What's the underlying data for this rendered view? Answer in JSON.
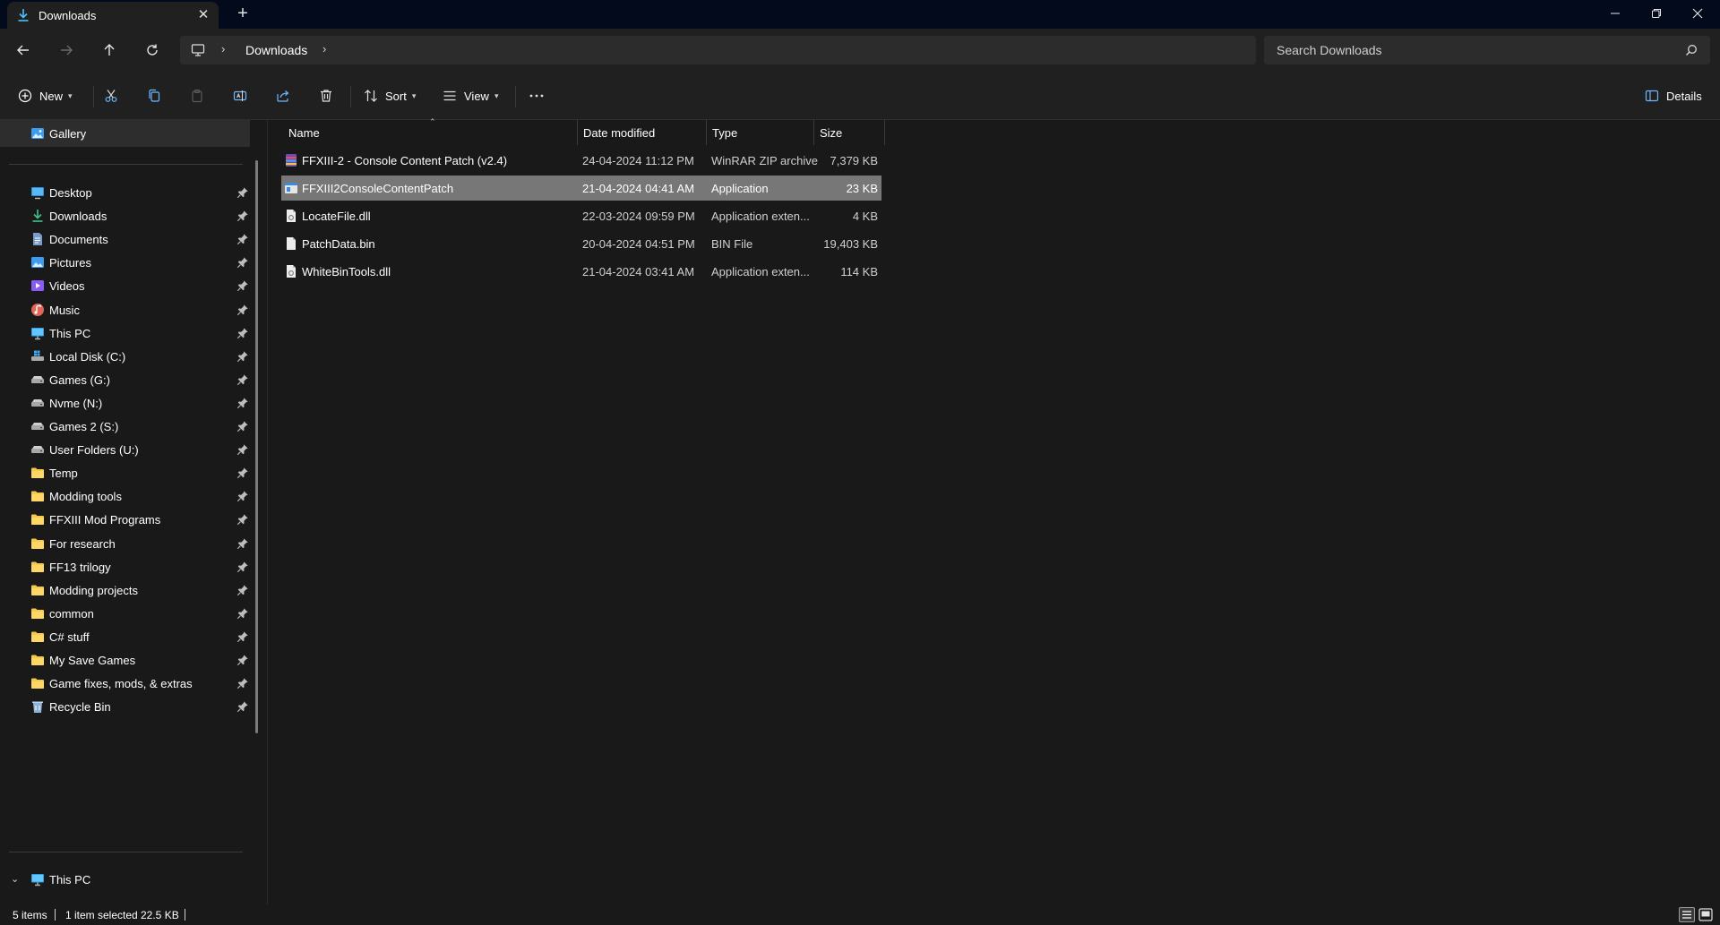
{
  "window": {
    "tab_title": "Downloads",
    "new_tab_label": "+",
    "close_tab_label": "✕"
  },
  "navigation": {
    "breadcrumb": [
      "Downloads"
    ],
    "search_placeholder": "Search Downloads"
  },
  "toolbar": {
    "new_label": "New",
    "sort_label": "Sort",
    "view_label": "View",
    "details_label": "Details"
  },
  "sidebar": {
    "gallery": "Gallery",
    "pinned": [
      {
        "label": "Desktop",
        "icon": "desktop-icon"
      },
      {
        "label": "Downloads",
        "icon": "download-icon"
      },
      {
        "label": "Documents",
        "icon": "document-icon"
      },
      {
        "label": "Pictures",
        "icon": "pictures-icon"
      },
      {
        "label": "Videos",
        "icon": "videos-icon"
      },
      {
        "label": "Music",
        "icon": "music-icon"
      },
      {
        "label": "This PC",
        "icon": "pc-icon"
      },
      {
        "label": "Local Disk (C:)",
        "icon": "windows-drive-icon"
      },
      {
        "label": "Games (G:)",
        "icon": "drive-icon"
      },
      {
        "label": "Nvme (N:)",
        "icon": "drive-icon"
      },
      {
        "label": "Games 2 (S:)",
        "icon": "drive-icon"
      },
      {
        "label": "User Folders (U:)",
        "icon": "drive-icon"
      },
      {
        "label": "Temp",
        "icon": "folder-icon"
      },
      {
        "label": "Modding tools",
        "icon": "folder-icon"
      },
      {
        "label": "FFXIII Mod Programs",
        "icon": "folder-icon"
      },
      {
        "label": "For research",
        "icon": "folder-icon"
      },
      {
        "label": "FF13 trilogy",
        "icon": "folder-icon"
      },
      {
        "label": "Modding projects",
        "icon": "folder-icon"
      },
      {
        "label": "common",
        "icon": "folder-icon"
      },
      {
        "label": "C# stuff",
        "icon": "folder-icon"
      },
      {
        "label": "My Save Games",
        "icon": "folder-icon"
      },
      {
        "label": "Game fixes, mods, & extras",
        "icon": "folder-icon"
      },
      {
        "label": "Recycle Bin",
        "icon": "recycle-bin-icon"
      }
    ],
    "this_pc": "This PC"
  },
  "columns": {
    "name": "Name",
    "date": "Date modified",
    "type": "Type",
    "size": "Size"
  },
  "files": [
    {
      "name": "FFXIII-2 - Console Content Patch (v2.4)",
      "date": "24-04-2024 11:12 PM",
      "type": "WinRAR ZIP archive",
      "size": "7,379 KB",
      "icon": "zip-archive-icon"
    },
    {
      "name": "FFXIII2ConsoleContentPatch",
      "date": "21-04-2024 04:41 AM",
      "type": "Application",
      "size": "23 KB",
      "icon": "application-icon"
    },
    {
      "name": "LocateFile.dll",
      "date": "22-03-2024 09:59 PM",
      "type": "Application exten...",
      "size": "4 KB",
      "icon": "dll-file-icon"
    },
    {
      "name": "PatchData.bin",
      "date": "20-04-2024 04:51 PM",
      "type": "BIN File",
      "size": "19,403 KB",
      "icon": "file-icon"
    },
    {
      "name": "WhiteBinTools.dll",
      "date": "21-04-2024 03:41 AM",
      "type": "Application exten...",
      "size": "114 KB",
      "icon": "dll-file-icon"
    }
  ],
  "selected_file_index": 1,
  "status": {
    "items": "5 items",
    "selected": "1 item selected",
    "size": "22.5 KB"
  },
  "colors": {
    "accent": "#4cc2ff",
    "folder": "#f7c948",
    "selection": "#777777"
  }
}
